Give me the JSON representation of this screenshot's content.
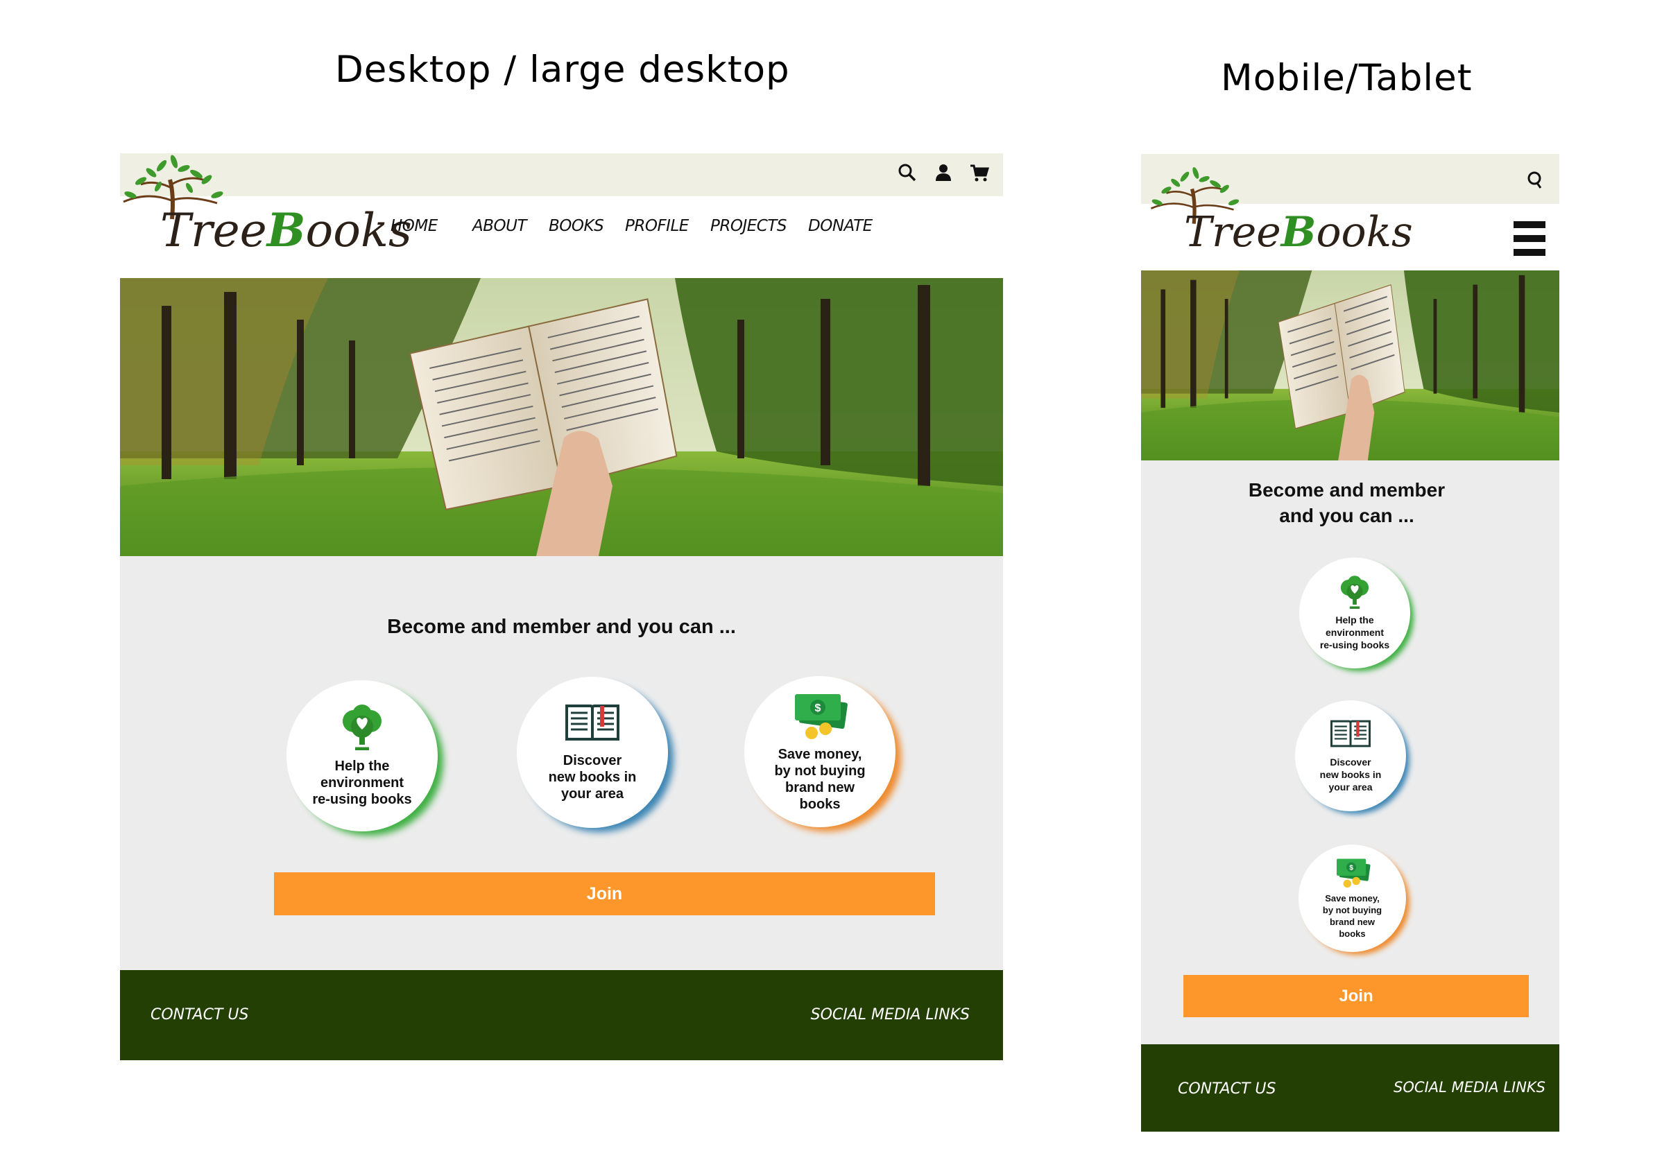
{
  "titles": {
    "desktop": "Desktop / large desktop",
    "mobile": "Mobile/Tablet"
  },
  "brand": {
    "logo_text_pre": "Tree",
    "logo_text_b": "B",
    "logo_text_post": "ooks"
  },
  "colors": {
    "topbar": "#eff0e3",
    "content_bg": "#ececec",
    "footer": "#233f03",
    "join": "#fd962b",
    "glow_green": "#3fb043",
    "glow_blue": "#3d86b5",
    "glow_orange": "#ef8a2c"
  },
  "desktop": {
    "nav": [
      "HOME",
      "ABOUT",
      "BOOKS",
      "PROFILE",
      "PROJECTS",
      "DONATE"
    ],
    "icons": [
      "search-icon",
      "user-icon",
      "cart-icon"
    ],
    "section_title": "Become and member and you can ...",
    "benefits": [
      {
        "icon": "tree-icon",
        "label": "Help the\nenvironment\nre-using books"
      },
      {
        "icon": "book-icon",
        "label": "Discover\nnew books in\nyour area"
      },
      {
        "icon": "money-icon",
        "label": "Save money,\nby not buying\nbrand new\nbooks"
      }
    ],
    "join": "Join",
    "footer": {
      "contact": "CONTACT US",
      "social": "SOCIAL MEDIA LINKS"
    }
  },
  "mobile": {
    "icons": [
      "search-icon",
      "hamburger-menu-icon"
    ],
    "section_title_line1": "Become and member",
    "section_title_line2": "and you can ...",
    "benefits": [
      {
        "icon": "tree-icon",
        "label": "Help the\nenvironment\nre-using books"
      },
      {
        "icon": "book-icon",
        "label": "Discover\nnew books in\nyour area"
      },
      {
        "icon": "money-icon",
        "label": "Save money,\nby not buying\nbrand new\nbooks"
      }
    ],
    "join": "Join",
    "footer": {
      "contact": "CONTACT US",
      "social": "SOCIAL MEDIA LINKS"
    }
  }
}
